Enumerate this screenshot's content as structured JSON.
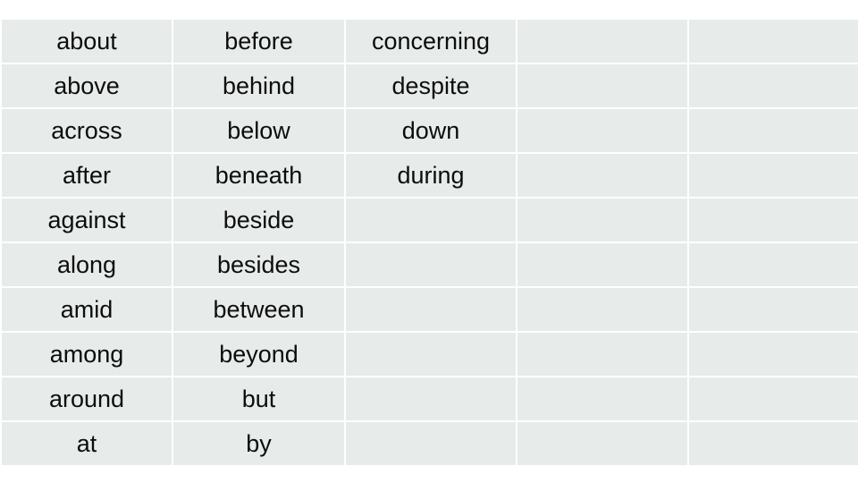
{
  "slide": {
    "background_color": "#ffffff",
    "cell_color": "#e7ecea",
    "text_color": "#0d0d0d",
    "gridline_color": "#ffffff"
  },
  "table": {
    "columns": 5,
    "rows": 10,
    "cells": [
      [
        "about",
        "before",
        "concerning",
        "",
        ""
      ],
      [
        "above",
        "behind",
        "despite",
        "",
        ""
      ],
      [
        "across",
        "below",
        "down",
        "",
        ""
      ],
      [
        "after",
        "beneath",
        "during",
        "",
        ""
      ],
      [
        "against",
        "beside",
        "",
        "",
        ""
      ],
      [
        "along",
        "besides",
        "",
        "",
        ""
      ],
      [
        "amid",
        "between",
        "",
        "",
        ""
      ],
      [
        "among",
        "beyond",
        "",
        "",
        ""
      ],
      [
        "around",
        "but",
        "",
        "",
        ""
      ],
      [
        "at",
        "by",
        "",
        "",
        ""
      ]
    ]
  }
}
